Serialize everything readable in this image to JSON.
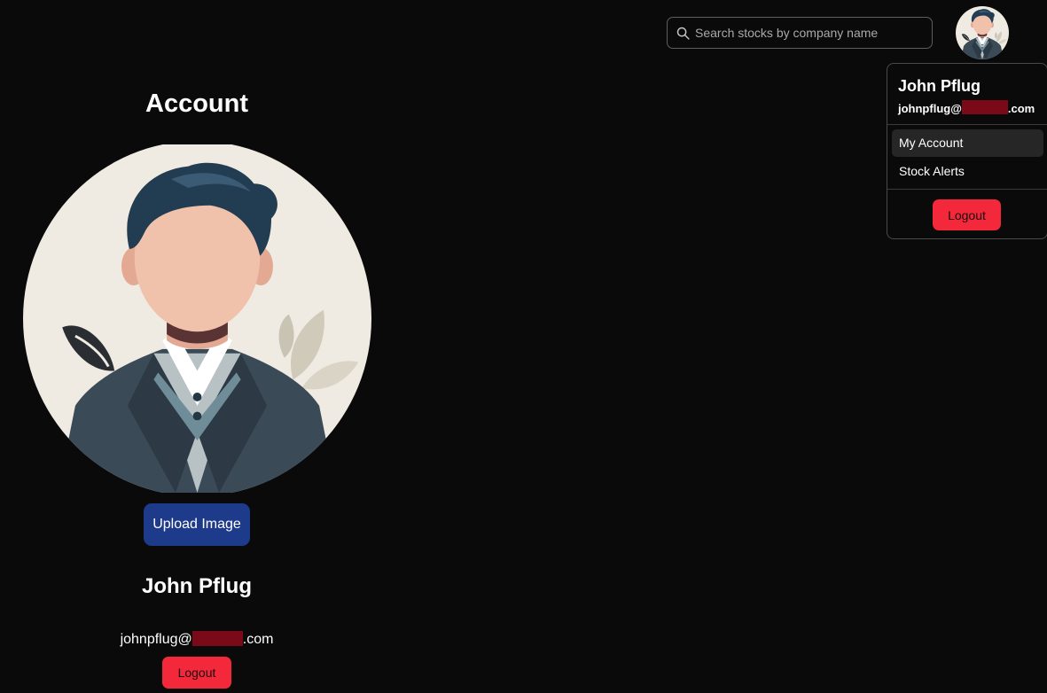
{
  "search": {
    "placeholder": "Search stocks by company name",
    "icon": "search-icon"
  },
  "user": {
    "name": "John Pflug",
    "email_prefix": "johnpflug@",
    "email_suffix": ".com",
    "avatar": "user-avatar-illustration"
  },
  "dropdown": {
    "items": [
      {
        "label": "My Account",
        "active": true
      },
      {
        "label": "Stock Alerts",
        "active": false
      }
    ],
    "logout_label": "Logout"
  },
  "account": {
    "title": "Account",
    "upload_label": "Upload Image",
    "logout_label": "Logout"
  },
  "colors": {
    "background": "#0a0a0a",
    "logout": "#f4283b",
    "upload": "#1e3a8a",
    "redaction": "#7a0a18"
  }
}
